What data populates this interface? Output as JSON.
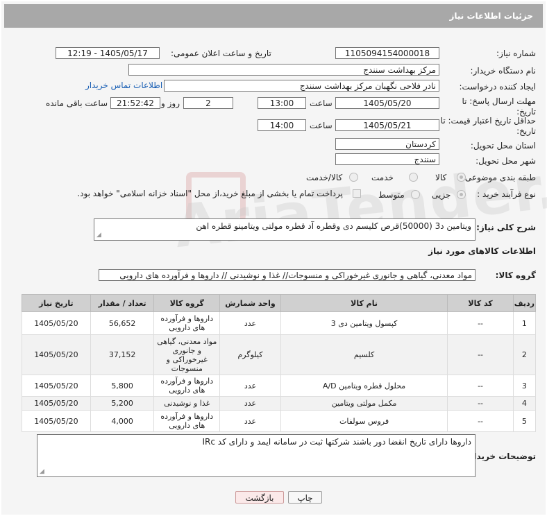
{
  "header": {
    "title": "جزئیات اطلاعات نیاز"
  },
  "fields": {
    "need_number_label": "شماره نیاز:",
    "need_number": "1105094154000018",
    "announce_label": "تاریخ و ساعت اعلان عمومی:",
    "announce_value": "1405/05/17 - 12:19",
    "buyer_org_label": "نام دستگاه خریدار:",
    "buyer_org": "مرکز بهداشت سنندج",
    "creator_label": "ایجاد کننده درخواست:",
    "creator": "نادر فلاحی نگهبان مرکز بهداشت سنندج",
    "contact_link": "اطلاعات تماس خریدار",
    "deadline_label": "مهلت ارسال پاسخ: تا تاریخ:",
    "deadline_date": "1405/05/20",
    "time_label": "ساعت",
    "deadline_time": "13:00",
    "days_value": "2",
    "days_label": "روز و",
    "remaining_time": "21:52:42",
    "remaining_label": "ساعت باقی مانده",
    "price_validity_label": "حداقل تاریخ اعتبار قیمت: تا تاریخ:",
    "price_validity_date": "1405/05/21",
    "price_validity_time": "14:00",
    "province_label": "استان محل تحویل:",
    "province": "کردستان",
    "city_label": "شهر محل تحویل:",
    "city": "سنندج",
    "category_label": "طبقه بندی موضوعی:",
    "category_options": [
      "کالا",
      "خدمت",
      "کالا/خدمت"
    ],
    "process_label": "نوع فرآیند خرید :",
    "process_options": [
      "جزیی",
      "متوسط"
    ],
    "payment_note": "پرداخت تمام یا بخشی از مبلغ خرید،از محل \"اسناد خزانه اسلامی\" خواهد بود."
  },
  "summary": {
    "label": "شرح کلی نیاز:",
    "text": "ویتامین د3 (50000)قرص کلیسم دی وقطره آد قطره مولتی ویتامینو قطره اهن"
  },
  "goods": {
    "section_title": "اطلاعات کالاهای مورد نیاز",
    "group_label": "گروه کالا:",
    "group_value": "مواد معدنی، گیاهی و جانوری غیرخوراکی و منسوجات// غذا و نوشیدنی // داروها و فرآورده های دارویی"
  },
  "table": {
    "headers": [
      "ردیف",
      "کد کالا",
      "نام کالا",
      "واحد شمارش",
      "گروه کالا",
      "تعداد / مقدار",
      "تاریخ نیاز"
    ],
    "rows": [
      [
        "1",
        "--",
        "کپسول ویتامین دی 3",
        "عدد",
        "داروها و فرآورده های دارویی",
        "56,652",
        "1405/05/20"
      ],
      [
        "2",
        "--",
        "کلسیم",
        "کیلوگرم",
        "مواد معدنی، گیاهی و جانوری غیرخوراکی و منسوجات",
        "37,152",
        "1405/05/20"
      ],
      [
        "3",
        "--",
        "محلول قطره ویتامین A/D",
        "عدد",
        "داروها و فرآورده های دارویی",
        "5,800",
        "1405/05/20"
      ],
      [
        "4",
        "--",
        "مکمل مولتی ویتامین",
        "عدد",
        "غذا و نوشیدنی",
        "5,200",
        "1405/05/20"
      ],
      [
        "5",
        "--",
        "فروس سولفات",
        "عدد",
        "داروها و فرآورده های دارویی",
        "4,000",
        "1405/05/20"
      ]
    ]
  },
  "buyer_notes": {
    "label": "توضیحات خریدار:",
    "text": "داروها دارای تاریخ انقضا دور باشند شرکتها ثبت در سامانه ایمد و دارای کد IRc"
  },
  "buttons": {
    "print": "چاپ",
    "back": "بازگشت"
  },
  "watermark": "AriaTender.neT"
}
